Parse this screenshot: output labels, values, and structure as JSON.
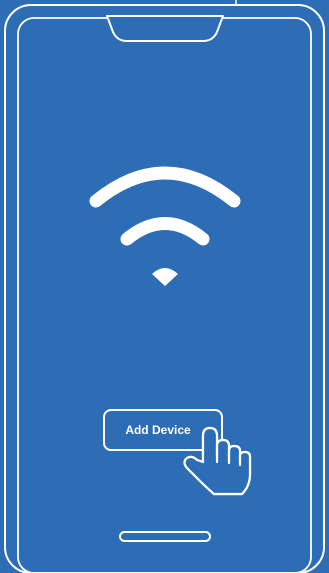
{
  "screen": {
    "background_color": "#2d6db5",
    "line_color": "#ffffff"
  },
  "icons": {
    "signal": "wifi-icon",
    "hand": "pointing-hand-icon",
    "home_indicator": "home-indicator"
  },
  "action": {
    "add_device_label": "Add Device"
  }
}
